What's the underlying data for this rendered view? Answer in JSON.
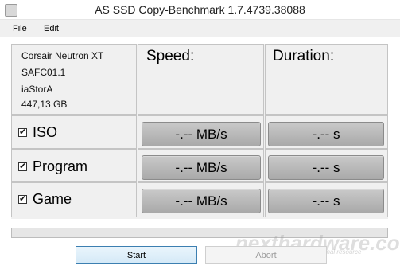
{
  "window": {
    "title": "AS SSD Copy-Benchmark 1.7.4739.38088"
  },
  "menu": {
    "file": "File",
    "edit": "Edit"
  },
  "drive": {
    "model": "Corsair Neutron XT",
    "firmware": "SAFC01.1",
    "driver": "iaStorA",
    "size": "447,13 GB"
  },
  "headers": {
    "speed": "Speed:",
    "duration": "Duration:"
  },
  "rows": [
    {
      "label": "ISO",
      "checked": true,
      "speed": "-.-- MB/s",
      "duration": "-.-- s"
    },
    {
      "label": "Program",
      "checked": true,
      "speed": "-.-- MB/s",
      "duration": "-.-- s"
    },
    {
      "label": "Game",
      "checked": true,
      "speed": "-.-- MB/s",
      "duration": "-.-- s"
    }
  ],
  "progress": {
    "value": 0
  },
  "buttons": {
    "start": "Start",
    "abort": "Abort"
  },
  "watermark": {
    "brand": "nexthardware.com",
    "tagline": "your ultimate professional resource"
  }
}
